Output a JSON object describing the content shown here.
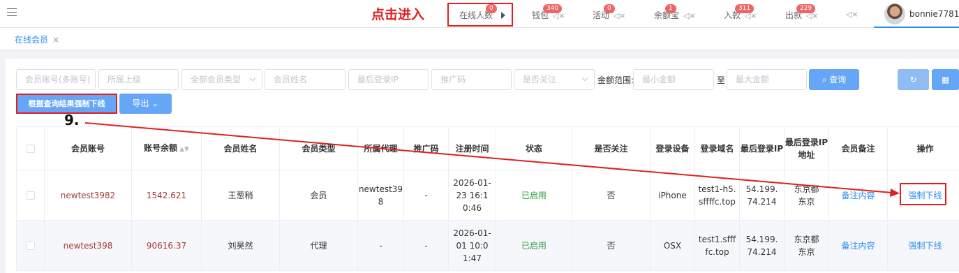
{
  "topbar": {
    "annotation": "点击进入",
    "nav": [
      {
        "label": "在线人数",
        "badge": "0"
      },
      {
        "label": "钱包",
        "badge": "340"
      },
      {
        "label": "活动",
        "badge": "0"
      },
      {
        "label": "余额宝",
        "badge": "1"
      },
      {
        "label": "入款",
        "badge": "311"
      },
      {
        "label": "出款",
        "badge": "229"
      }
    ],
    "username": "bonnie7781"
  },
  "tabs": [
    {
      "label": "在线会员",
      "close": "×"
    }
  ],
  "filters": {
    "account": "会员账号(多账号)",
    "superior": "所属上级",
    "member_type": "全部会员类型",
    "member_name": "会员姓名",
    "last_ip": "最后登录IP",
    "promo_code": "推广码",
    "follow": "是否关注",
    "amount_label": "金额范围:",
    "min_amount": "最小金额",
    "to_label": "至",
    "max_amount": "最大金额",
    "search_btn": "查询"
  },
  "actions": {
    "force_offline_all": "根据查询结果强制下线",
    "export": "导出",
    "annotation_step": "9."
  },
  "table": {
    "headers": [
      "会员账号",
      "账号余额",
      "会员姓名",
      "会员类型",
      "所属代理",
      "推广码",
      "注册时间",
      "状态",
      "是否关注",
      "登录设备",
      "登录域名",
      "最后登录IP",
      "最后登录IP地址",
      "会员备注",
      "操作"
    ],
    "rows": [
      {
        "account": "newtest3982",
        "balance": "1542.621",
        "name": "王葱稍",
        "type": "会员",
        "agent": "newtest398",
        "promo": "-",
        "reg_time": "2026-01-23 16:10:46",
        "status": "已启用",
        "follow": "否",
        "device": "iPhone",
        "domain": "test1-h5.sffffc.top",
        "ip": "54.199.74.214",
        "ip_loc": "东京都东京",
        "remark": "备注内容",
        "action": "强制下线"
      },
      {
        "account": "newtest398",
        "balance": "90616.37",
        "name": "刘昊然",
        "type": "代理",
        "agent": "-",
        "promo": "-",
        "reg_time": "2026-01-01 10:01:47",
        "status": "已启用",
        "follow": "否",
        "device": "OSX",
        "domain": "test1.sffffc.top",
        "ip": "54.199.74.214",
        "ip_loc": "东京都东京",
        "remark": "备注内容",
        "action": "强制下线"
      }
    ]
  },
  "colors": {
    "accent": "#2d8cf0",
    "annotation": "#e02020",
    "primary_button": "#66a6f7",
    "badge": "#e96767"
  }
}
